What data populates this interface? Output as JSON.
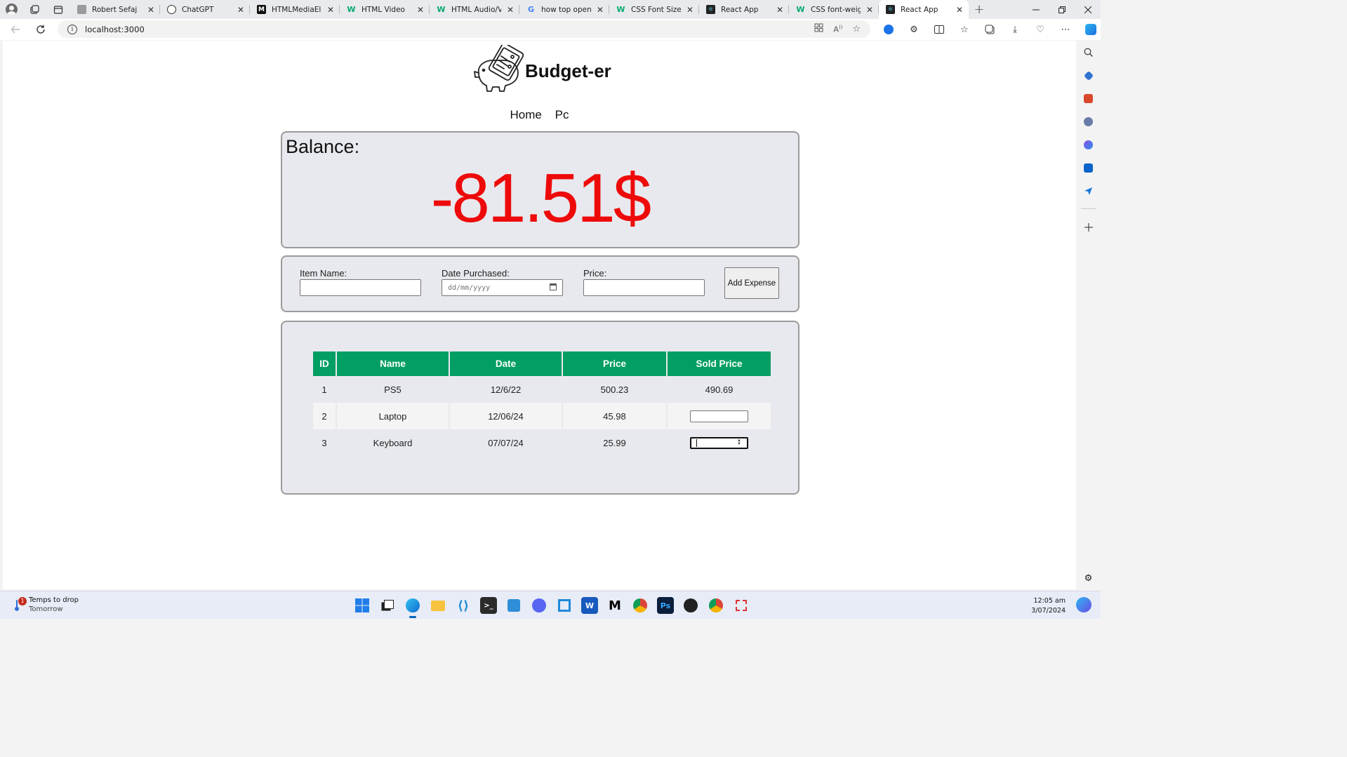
{
  "browser": {
    "tabs": [
      {
        "title": "Robert Sefaj",
        "icon": "profile-tab-icon",
        "color": "#8a8a8a"
      },
      {
        "title": "ChatGPT",
        "icon": "chatgpt-icon",
        "color": "#333333"
      },
      {
        "title": "HTMLMediaElem",
        "icon": "mdn-icon",
        "color": "#111111"
      },
      {
        "title": "HTML Video",
        "icon": "w3schools-icon",
        "color": "#04aa6d"
      },
      {
        "title": "HTML Audio/Vid",
        "icon": "w3schools-icon",
        "color": "#04aa6d"
      },
      {
        "title": "how top open q",
        "icon": "google-icon",
        "color": "#4285f4"
      },
      {
        "title": "CSS Font Size",
        "icon": "w3schools-icon",
        "color": "#04aa6d"
      },
      {
        "title": "React App",
        "icon": "react-icon",
        "color": "#222222"
      },
      {
        "title": "CSS font-weight",
        "icon": "w3schools-icon",
        "color": "#04aa6d"
      },
      {
        "title": "React App",
        "icon": "react-icon",
        "color": "#222222",
        "active": true
      }
    ],
    "close_glyph": "✕",
    "new_tab_glyph": "+",
    "url": "localhost:3000"
  },
  "page": {
    "app_title": "Budget-er",
    "nav": [
      {
        "label": "Home"
      },
      {
        "label": "Pc"
      }
    ],
    "balance_label": "Balance:",
    "balance_value": "-81.51$",
    "balance_color": "#ee0a0a",
    "form": {
      "item_name_label": "Item Name:",
      "item_name_value": "",
      "date_label": "Date Purchased:",
      "date_placeholder": "dd/mm/yyyy",
      "price_label": "Price:",
      "price_value": "",
      "add_button": "Add Expense"
    },
    "table": {
      "header_color": "#039e63",
      "headers": [
        "ID",
        "Name",
        "Date",
        "Price",
        "Sold Price"
      ],
      "rows": [
        {
          "id": "1",
          "name": "PS5",
          "date": "12/6/22",
          "price": "500.23",
          "sold_price": "490.69"
        },
        {
          "id": "2",
          "name": "Laptop",
          "date": "12/06/24",
          "price": "45.98",
          "sold_price": ""
        },
        {
          "id": "3",
          "name": "Keyboard",
          "date": "07/07/24",
          "price": "25.99",
          "sold_price": ""
        }
      ]
    }
  },
  "taskbar": {
    "weather_line1": "Temps to drop",
    "weather_line2": "Tomorrow",
    "notification_count": "1",
    "time": "12:05 am",
    "date": "3/07/2024"
  }
}
